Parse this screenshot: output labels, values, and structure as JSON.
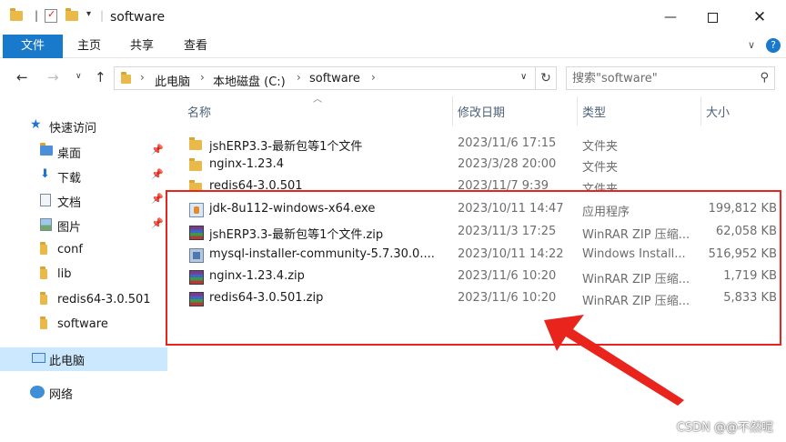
{
  "window": {
    "title": "software"
  },
  "ribbon": {
    "tabs": [
      "文件",
      "主页",
      "共享",
      "查看"
    ]
  },
  "address": {
    "crumbs": [
      "此电脑",
      "本地磁盘 (C:)",
      "software"
    ],
    "search_placeholder": "搜索\"software\""
  },
  "sidebar": {
    "items": [
      {
        "label": "快速访问",
        "icon": "star-icon"
      },
      {
        "label": "桌面",
        "icon": "desktop-folder-icon",
        "pinned": true
      },
      {
        "label": "下载",
        "icon": "download-folder-icon",
        "pinned": true
      },
      {
        "label": "文档",
        "icon": "documents-folder-icon",
        "pinned": true
      },
      {
        "label": "图片",
        "icon": "pictures-folder-icon",
        "pinned": true
      },
      {
        "label": "conf",
        "icon": "folder-icon"
      },
      {
        "label": "lib",
        "icon": "folder-icon"
      },
      {
        "label": "redis64-3.0.501",
        "icon": "folder-icon"
      },
      {
        "label": "software",
        "icon": "folder-icon"
      },
      {
        "label": "此电脑",
        "icon": "computer-icon",
        "selected": true
      },
      {
        "label": "网络",
        "icon": "network-icon"
      }
    ]
  },
  "filelist": {
    "columns": [
      "名称",
      "修改日期",
      "类型",
      "大小"
    ],
    "rows": [
      {
        "name": "jshERP3.3-最新包等1个文件",
        "date": "2023/11/6 17:15",
        "type": "文件夹",
        "size": "",
        "icon": "folder"
      },
      {
        "name": "nginx-1.23.4",
        "date": "2023/3/28 20:00",
        "type": "文件夹",
        "size": "",
        "icon": "folder"
      },
      {
        "name": "redis64-3.0.501",
        "date": "2023/11/7 9:39",
        "type": "文件夹",
        "size": "",
        "icon": "folder"
      },
      {
        "name": "jdk-8u112-windows-x64.exe",
        "date": "2023/10/11 14:47",
        "type": "应用程序",
        "size": "199,812 KB",
        "icon": "exe"
      },
      {
        "name": "jshERP3.3-最新包等1个文件.zip",
        "date": "2023/11/3 17:25",
        "type": "WinRAR ZIP 压缩...",
        "size": "62,058 KB",
        "icon": "zip"
      },
      {
        "name": "mysql-installer-community-5.7.30.0....",
        "date": "2023/10/11 14:22",
        "type": "Windows Install...",
        "size": "516,952 KB",
        "icon": "msi"
      },
      {
        "name": "nginx-1.23.4.zip",
        "date": "2023/11/6 10:20",
        "type": "WinRAR ZIP 压缩...",
        "size": "1,719 KB",
        "icon": "zip"
      },
      {
        "name": "redis64-3.0.501.zip",
        "date": "2023/11/6 10:20",
        "type": "WinRAR ZIP 压缩...",
        "size": "5,833 KB",
        "icon": "zip"
      }
    ]
  },
  "annotation": {
    "box_color": "#e8241d",
    "watermark": "CSDN @@不然呢"
  }
}
